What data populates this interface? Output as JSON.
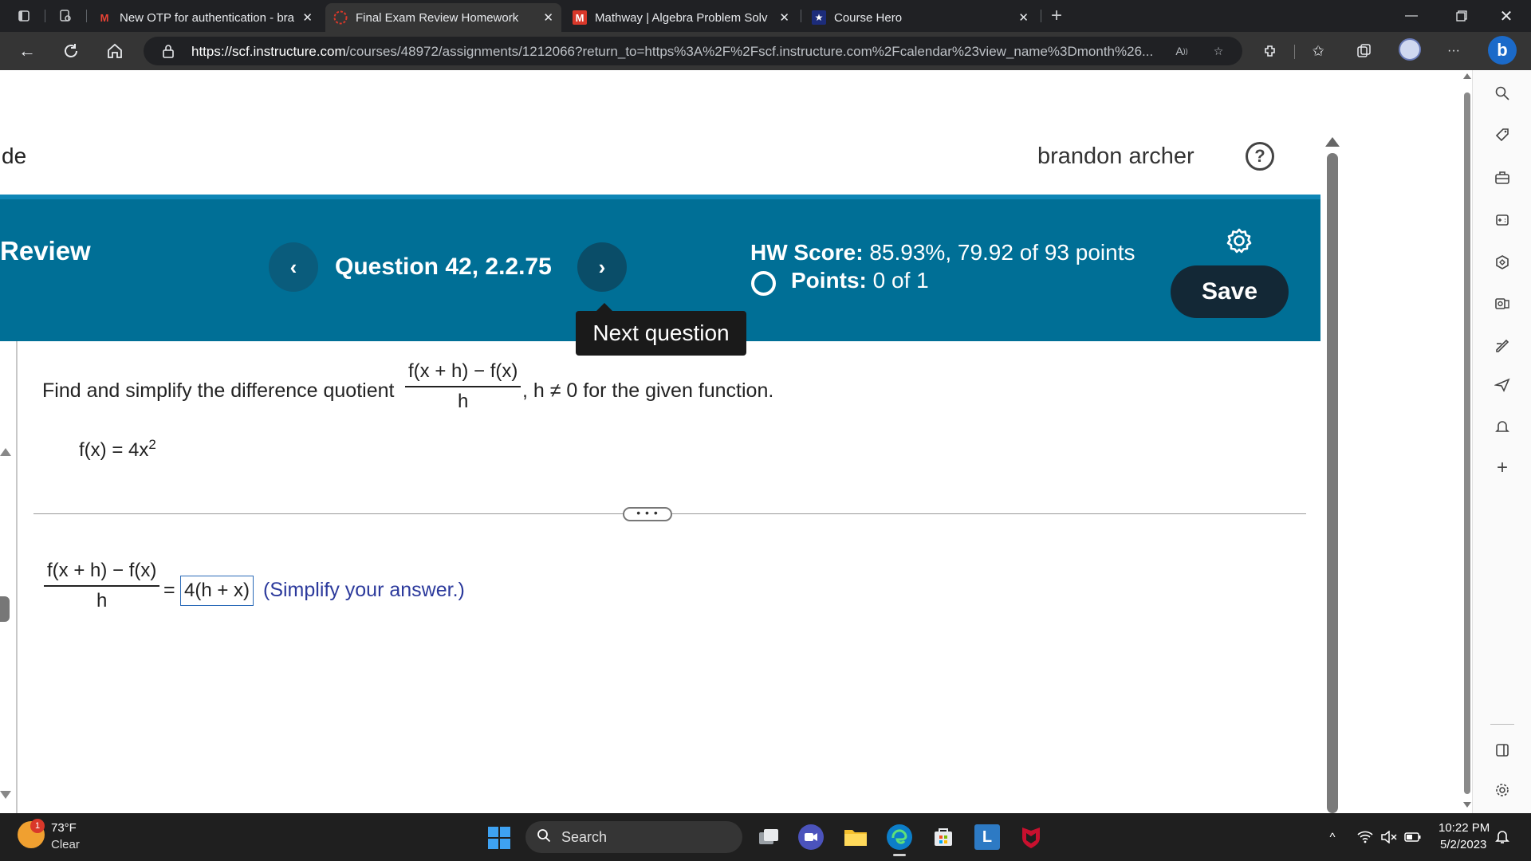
{
  "browser": {
    "tabs": [
      {
        "label": "New OTP for authentication - bra",
        "icon": "gmail-icon"
      },
      {
        "label": "Final Exam Review Homework",
        "icon": "pearson-icon"
      },
      {
        "label": "Mathway | Algebra Problem Solv",
        "icon": "mathway-icon"
      },
      {
        "label": "Course Hero",
        "icon": "coursehero-icon"
      }
    ],
    "url_host": "https://scf.instructure.com",
    "url_path": "/courses/48972/assignments/1212066?return_to=https%3A%2F%2Fscf.instructure.com%2Fcalendar%23view_name%3Dmonth%26..."
  },
  "header": {
    "site_title": "de",
    "username": "brandon archer"
  },
  "band": {
    "title": "Review",
    "question_label": "Question 42, 2.2.75",
    "hw_score_label": "HW Score:",
    "hw_score_value": "85.93%, 79.92 of 93 points",
    "points_label": "Points:",
    "points_value": "0 of 1",
    "save_label": "Save",
    "tooltip": "Next question"
  },
  "question": {
    "prompt": "Find and simplify the difference quotient",
    "quotient_numerator": "f(x + h) − f(x)",
    "quotient_denominator": "h",
    "prompt_tail": ", h ≠ 0 for the given function.",
    "function_lhs": "f(x) = 4x",
    "function_exponent": "2",
    "answer_numerator": "f(x + h) − f(x)",
    "answer_denominator": "h",
    "equals": "=",
    "answer_value": "4(h + x)",
    "answer_hint": "(Simplify your answer.)",
    "more_label": "• • •"
  },
  "taskbar": {
    "weather_badge": "1",
    "temperature": "73°F",
    "condition": "Clear",
    "search_label": "Search",
    "time": "10:22 PM",
    "date": "5/2/2023"
  },
  "colors": {
    "band": "#006f96",
    "save_button": "#132836",
    "hint": "#2c3a9c"
  }
}
